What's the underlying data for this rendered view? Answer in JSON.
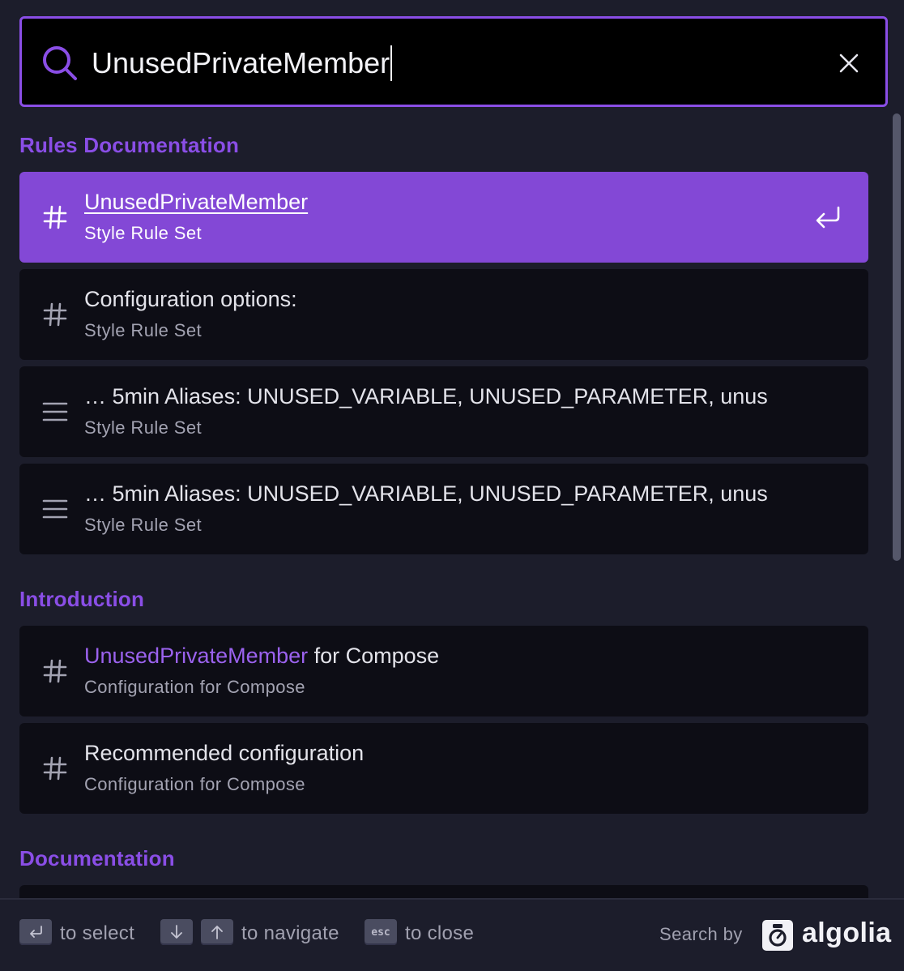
{
  "search": {
    "query": "UnusedPrivateMember",
    "icon": "search-icon",
    "clear_icon": "close-icon"
  },
  "colors": {
    "accent": "#8a4ee6",
    "selected_bg": "#8348d6",
    "modal_bg": "#1c1d2b",
    "hit_bg": "#0d0d15"
  },
  "sections": [
    {
      "title": "Rules Documentation",
      "hits": [
        {
          "icon": "hash-icon",
          "title": "UnusedPrivateMember",
          "subtitle": "Style Rule Set",
          "selected": true
        },
        {
          "icon": "hash-icon",
          "title": "Configuration options:",
          "subtitle": "Style Rule Set"
        },
        {
          "icon": "text-lines-icon",
          "title": "… 5min Aliases: UNUSED_VARIABLE, UNUSED_PARAMETER, unus",
          "subtitle": "Style Rule Set"
        },
        {
          "icon": "text-lines-icon",
          "title": "… 5min Aliases: UNUSED_VARIABLE, UNUSED_PARAMETER, unus",
          "subtitle": "Style Rule Set"
        }
      ]
    },
    {
      "title": "Introduction",
      "hits": [
        {
          "icon": "hash-icon",
          "title_highlight": "UnusedPrivateMember",
          "title_rest": " for Compose",
          "subtitle": "Configuration for Compose"
        },
        {
          "icon": "hash-icon",
          "title": "Recommended configuration",
          "subtitle": "Configuration for Compose"
        }
      ]
    },
    {
      "title": "Documentation",
      "hits": []
    }
  ],
  "footer": {
    "select_label": "to select",
    "navigate_label": "to navigate",
    "close_label": "to close",
    "esc_key": "esc",
    "search_by": "Search by",
    "brand": "algolia"
  }
}
